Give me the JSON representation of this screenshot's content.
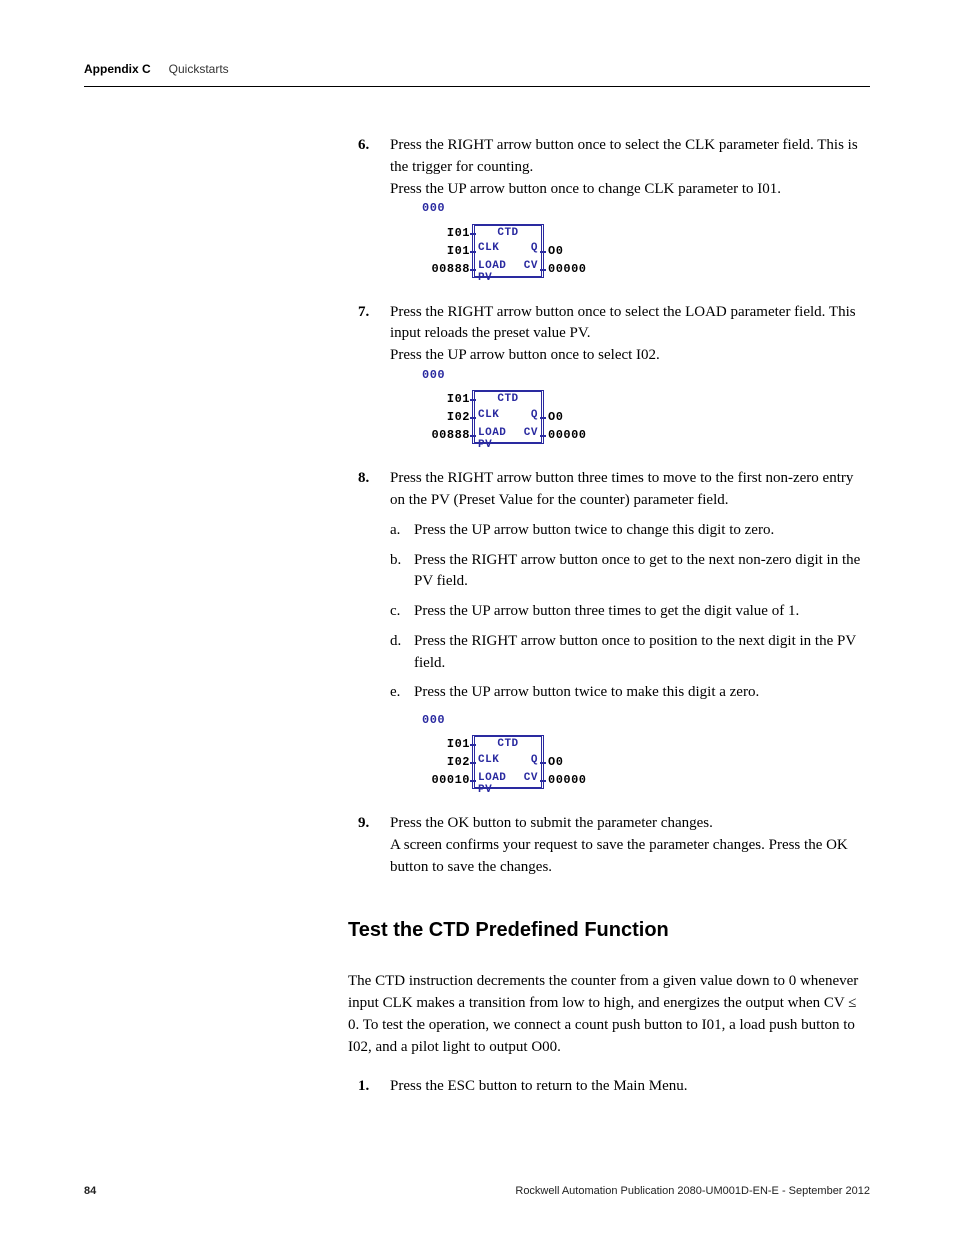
{
  "header": {
    "bold": "Appendix C",
    "light": "Quickstarts"
  },
  "footer": {
    "pagenum": "84",
    "pub": "Rockwell Automation Publication 2080-UM001D-EN-E - September 2012"
  },
  "steps": {
    "s6a": "Press the RIGHT arrow button once to select the CLK parameter field. This is the trigger for counting.",
    "s6b": "Press the UP arrow button once to change CLK parameter to I01.",
    "s7a": "Press the RIGHT arrow button once to select the LOAD parameter field. This input reloads the preset value PV.",
    "s7b": "Press the UP arrow button once to select I02.",
    "s8": "Press the RIGHT arrow button three times to move to the first non-zero entry on the PV (Preset Value for the counter) parameter field.",
    "s8a": "Press the UP arrow button twice to change this digit to zero.",
    "s8b": "Press the RIGHT arrow button once to get to the next non-zero digit in the PV field.",
    "s8c": "Press the UP arrow button three times to get the digit value of 1.",
    "s8d": "Press the RIGHT arrow button once to position to the next digit in the PV field.",
    "s8e": "Press the UP arrow button twice to make this digit a zero.",
    "s9a": "Press the OK button to submit the parameter changes.",
    "s9b": "A screen confirms your request to save the parameter changes. Press the OK button to save the changes."
  },
  "section": {
    "title": "Test the CTD Predefined Function"
  },
  "para1": "The CTD instruction decrements the counter from a given value down to 0 whenever input CLK makes a transition from low to high, and energizes the output when CV ≤ 0. To test the operation, we connect a count push button to I01, a load push button to I02, and a pilot light to output O00.",
  "steps2": {
    "s1": "Press the ESC button to return to the Main Menu."
  },
  "ctd": {
    "n000": "000",
    "title": "CTD",
    "clk": "CLK",
    "load": "LOAD",
    "pv": "PV",
    "q": "Q",
    "cv": "CV",
    "o0": "O0",
    "z5": "00000",
    "block1": {
      "l1": "I01",
      "l2": "I01",
      "l3": "00888"
    },
    "block2": {
      "l1": "I01",
      "l2": "I02",
      "l3": "00888"
    },
    "block3": {
      "l1": "I01",
      "l2": "I02",
      "l3": "00010"
    }
  }
}
